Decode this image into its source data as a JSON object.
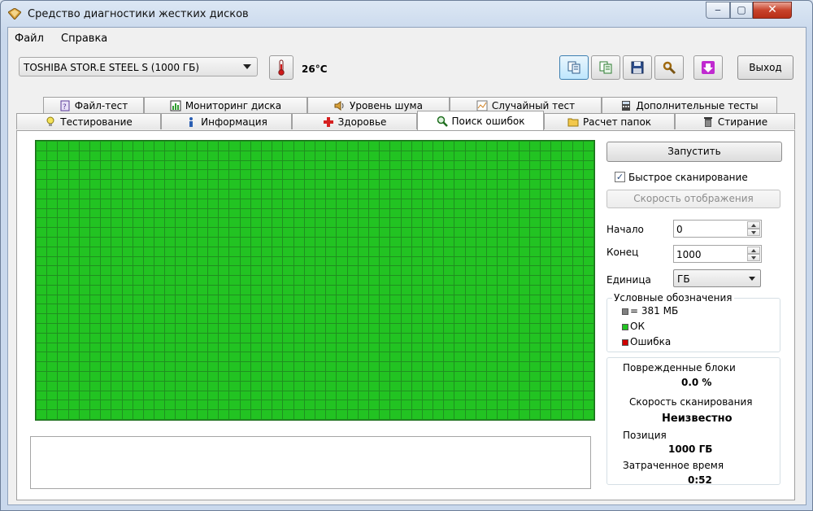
{
  "window": {
    "title": "Средство диагностики жестких дисков",
    "min": "‒",
    "max": "▢",
    "close": "✕"
  },
  "menu": [
    {
      "label": "Файл"
    },
    {
      "label": "Справка"
    }
  ],
  "toolbar": {
    "drive": "TOSHIBA STOR.E STEEL S  (1000 ГБ)",
    "temperature": "26°C",
    "exit_label": "Выход"
  },
  "tabs_top": [
    {
      "label": "Файл-тест",
      "icon": "file-test-icon"
    },
    {
      "label": "Мониторинг диска",
      "icon": "chart-icon"
    },
    {
      "label": "Уровень шума",
      "icon": "speaker-icon"
    },
    {
      "label": "Случайный тест",
      "icon": "random-icon"
    },
    {
      "label": "Дополнительные тесты",
      "icon": "calculator-icon"
    }
  ],
  "tabs_bottom": [
    {
      "label": "Тестирование",
      "icon": "bulb-icon"
    },
    {
      "label": "Информация",
      "icon": "info-icon"
    },
    {
      "label": "Здоровье",
      "icon": "health-cross-icon"
    },
    {
      "label": "Поиск ошибок",
      "icon": "magnifier-icon",
      "selected": true
    },
    {
      "label": "Расчет папок",
      "icon": "folder-icon"
    },
    {
      "label": "Стирание",
      "icon": "trash-icon"
    }
  ],
  "scan": {
    "start_label": "Запустить",
    "fast_scan_label": "Быстрое сканирование",
    "fast_scan_checked": true,
    "display_speed_label": "Скорость отображения",
    "start_field_label": "Начало",
    "start_value": "0",
    "end_field_label": "Конец",
    "end_value": "1000",
    "unit_label": "Единица",
    "unit_value": "ГБ"
  },
  "legend": {
    "title": "Условные обозначения",
    "items": [
      {
        "label": "= 381 МБ",
        "color": "#808080"
      },
      {
        "label": "ОК",
        "color": "#22c322"
      },
      {
        "label": "Ошибка",
        "color": "#d00000"
      }
    ]
  },
  "stats": {
    "damaged_label": "Поврежденные блоки",
    "damaged_value": "0.0 %",
    "speed_label": "Скорость сканирования",
    "speed_value": "Неизвестно",
    "position_label": "Позиция",
    "position_value": "1000 ГБ",
    "elapsed_label": "Затраченное время",
    "elapsed_value": "0:52"
  },
  "colors": {
    "ok": "#22c322",
    "grid_border": "#1f8f1f"
  }
}
